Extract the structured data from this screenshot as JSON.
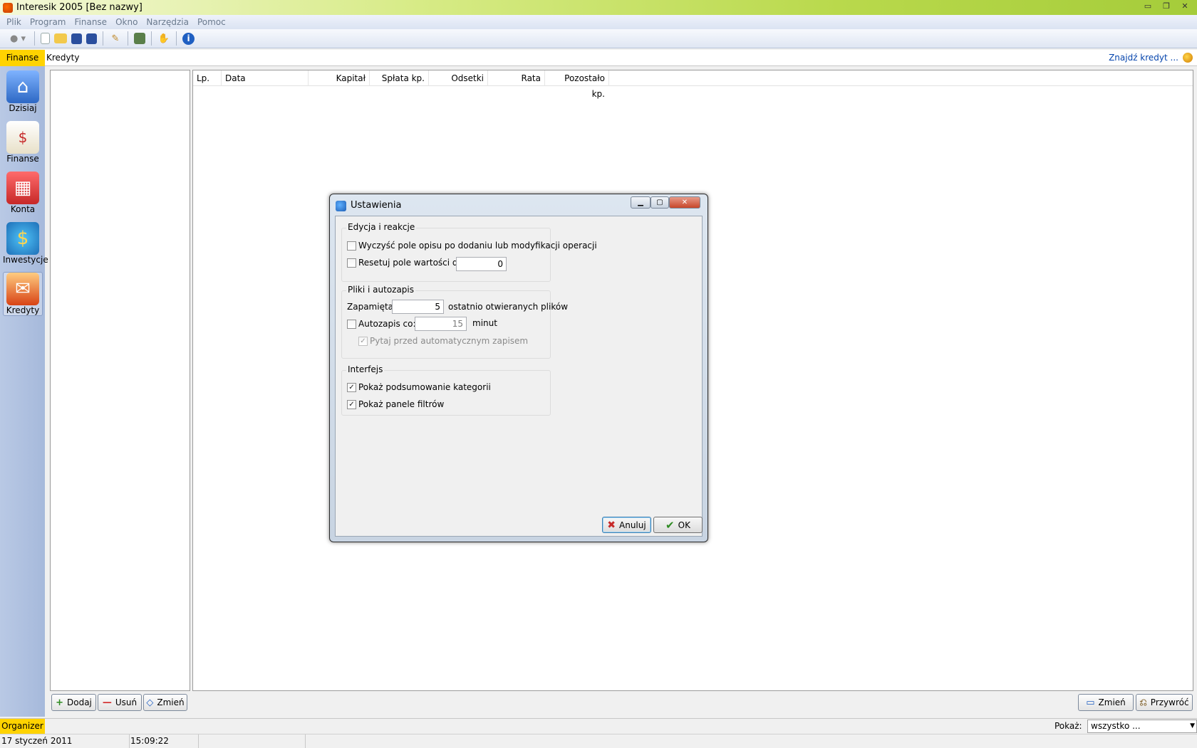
{
  "window": {
    "title": "Interesik 2005 [Bez nazwy]",
    "controls": [
      "▭",
      "❐",
      "✕"
    ]
  },
  "menu": [
    "Plik",
    "Program",
    "Finanse",
    "Okno",
    "Narzędzia",
    "Pomoc"
  ],
  "toolbar": {
    "icons": [
      "back-icon",
      "new-file-icon",
      "open-folder-icon",
      "save-icon",
      "save-all-icon",
      "tools-icon",
      "report-icon",
      "hand-icon",
      "info-icon"
    ]
  },
  "tabstrip": {
    "active_tab": "Finanse",
    "crumb": "Kredyty",
    "find_link": "Znajdź kredyt ..."
  },
  "leftnav": {
    "items": [
      {
        "label": "Dzisiaj",
        "icon": "house-icon"
      },
      {
        "label": "Finanse",
        "icon": "finance-icon"
      },
      {
        "label": "Konta",
        "icon": "accounts-icon"
      },
      {
        "label": "Inwestycje",
        "icon": "investments-icon"
      },
      {
        "label": "Kredyty",
        "icon": "credits-icon"
      }
    ],
    "selected": "Kredyty"
  },
  "grid": {
    "columns": [
      "Lp.",
      "Data",
      "Kapitał",
      "Spłata kp.",
      "Odsetki",
      "Rata",
      "Pozostało kp."
    ]
  },
  "bottom_left_buttons": {
    "add": "Dodaj",
    "remove": "Usuń",
    "edit": "Zmień"
  },
  "bottom_right_buttons": {
    "edit": "Zmień",
    "restore": "Przywróć"
  },
  "organizer": {
    "tab": "Organizer",
    "show_label": "Pokaż:",
    "show_value": "wszystko ..."
  },
  "status": {
    "date": "17 styczeń 2011",
    "time": "15:09:22"
  },
  "dialog": {
    "title": "Ustawienia",
    "groups": {
      "editing": {
        "legend": "Edycja i reakcje",
        "clear_desc": {
          "label": "Wyczyść pole opisu po dodaniu lub modyfikacji operacji",
          "checked": false
        },
        "reset_value": {
          "label": "Resetuj pole wartości do:",
          "checked": false,
          "value": "0"
        }
      },
      "files": {
        "legend": "Pliki i autozapis",
        "remember_label": "Zapamiętaj",
        "remember_value": "5",
        "remember_suffix": "ostatnio otwieranych plików",
        "autosave": {
          "label": "Autozapis co:",
          "checked": false,
          "value": "15"
        },
        "autosave_unit": "minut",
        "ask_before": {
          "label": "Pytaj przed automatycznym zapisem",
          "checked": true,
          "enabled": false
        }
      },
      "interface": {
        "legend": "Interfejs",
        "show_category_summary": {
          "label": "Pokaż podsumowanie kategorii",
          "checked": true
        },
        "show_filter_panels": {
          "label": "Pokaż panele filtrów",
          "checked": true
        }
      }
    },
    "buttons": {
      "cancel": "Anuluj",
      "ok": "OK"
    }
  }
}
